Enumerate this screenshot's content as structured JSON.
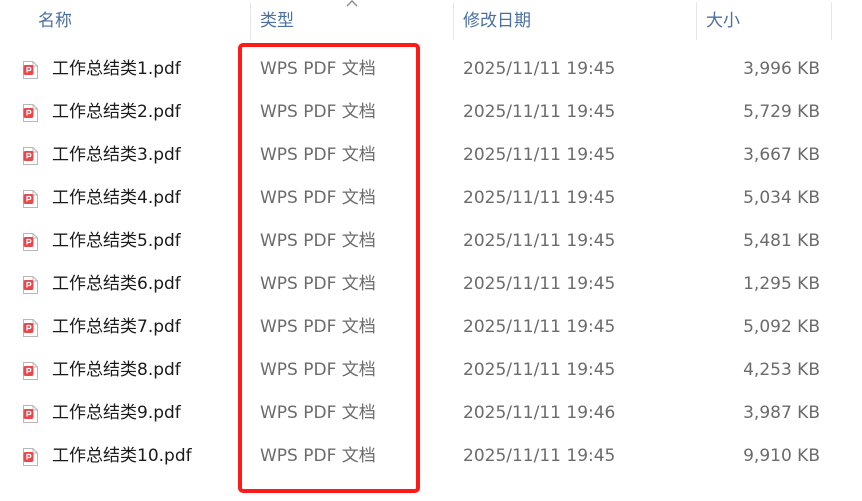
{
  "header": {
    "col_name": "名称",
    "col_type": "类型",
    "col_date": "修改日期",
    "col_size": "大小"
  },
  "icons": {
    "file": "pdf-file-icon",
    "sort": "chevron-up-icon"
  },
  "colors": {
    "header_text": "#4a6fa0",
    "highlight_border": "#ff1a1a",
    "pdf_icon": "#e8474c"
  },
  "files": [
    {
      "name": "工作总结类1.pdf",
      "type": "WPS PDF 文档",
      "date": "2025/11/11 19:45",
      "size": "3,996 KB"
    },
    {
      "name": "工作总结类2.pdf",
      "type": "WPS PDF 文档",
      "date": "2025/11/11 19:45",
      "size": "5,729 KB"
    },
    {
      "name": "工作总结类3.pdf",
      "type": "WPS PDF 文档",
      "date": "2025/11/11 19:45",
      "size": "3,667 KB"
    },
    {
      "name": "工作总结类4.pdf",
      "type": "WPS PDF 文档",
      "date": "2025/11/11 19:45",
      "size": "5,034 KB"
    },
    {
      "name": "工作总结类5.pdf",
      "type": "WPS PDF 文档",
      "date": "2025/11/11 19:45",
      "size": "5,481 KB"
    },
    {
      "name": "工作总结类6.pdf",
      "type": "WPS PDF 文档",
      "date": "2025/11/11 19:45",
      "size": "1,295 KB"
    },
    {
      "name": "工作总结类7.pdf",
      "type": "WPS PDF 文档",
      "date": "2025/11/11 19:45",
      "size": "5,092 KB"
    },
    {
      "name": "工作总结类8.pdf",
      "type": "WPS PDF 文档",
      "date": "2025/11/11 19:45",
      "size": "4,253 KB"
    },
    {
      "name": "工作总结类9.pdf",
      "type": "WPS PDF 文档",
      "date": "2025/11/11 19:46",
      "size": "3,987 KB"
    },
    {
      "name": "工作总结类10.pdf",
      "type": "WPS PDF 文档",
      "date": "2025/11/11 19:45",
      "size": "9,910 KB"
    }
  ]
}
